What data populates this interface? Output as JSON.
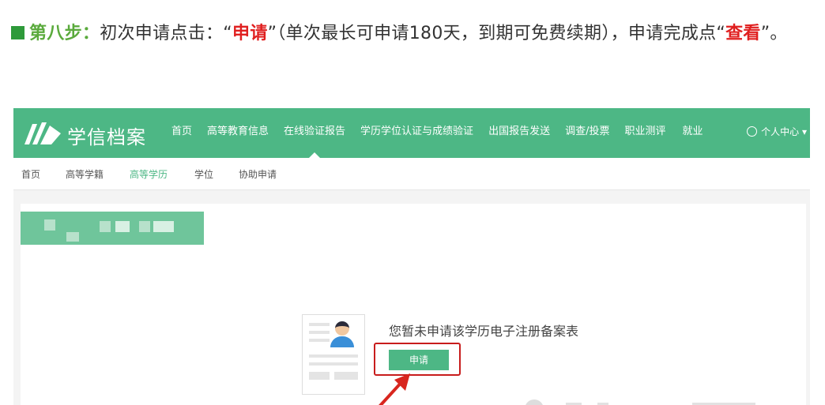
{
  "instruction": {
    "step_label": "第八步：",
    "text_a": "初次申请点击：“",
    "apply_word": "申请",
    "text_b": "”（单次最长可申请180天，到期可免费续期），申请完成点“",
    "view_word": "查看",
    "text_c": "”。"
  },
  "nav": {
    "brand": "学信档案",
    "items": [
      "首页",
      "高等教育信息",
      "在线验证报告",
      "学历学位认证与成绩验证",
      "出国报告发送",
      "调查/投票",
      "职业测评",
      "就业"
    ],
    "active_index": 2,
    "user_center": "个人中心 ▾"
  },
  "subnav": {
    "items": [
      "首页",
      "高等学籍",
      "高等学历",
      "学位",
      "协助申请"
    ],
    "active_index": 2
  },
  "main": {
    "empty_message": "您暂未申请该学历电子注册备案表",
    "apply_button": "申请"
  },
  "colors": {
    "nav_green": "#4db785",
    "highlight_red": "#c81c1c",
    "step_green": "#5aaa3c"
  }
}
